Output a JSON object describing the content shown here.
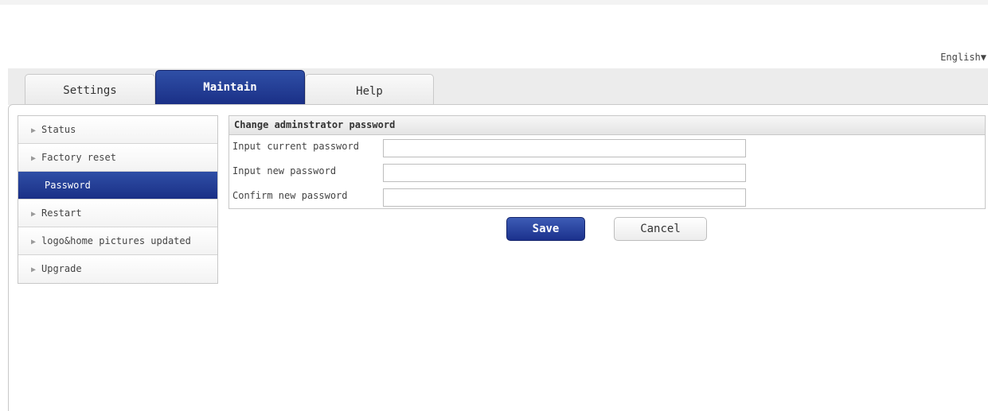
{
  "header": {
    "language": "English▼"
  },
  "tabs": [
    {
      "label": "Settings"
    },
    {
      "label": "Maintain"
    },
    {
      "label": "Help"
    }
  ],
  "sidebar": {
    "items": [
      {
        "label": "Status",
        "active": false
      },
      {
        "label": "Factory reset",
        "active": false
      },
      {
        "label": "Password",
        "active": true
      },
      {
        "label": "Restart",
        "active": false
      },
      {
        "label": "logo&home pictures updated",
        "active": false
      },
      {
        "label": "Upgrade",
        "active": false
      }
    ],
    "arrow": "▶"
  },
  "panel": {
    "title": "Change adminstrator password",
    "fields": [
      {
        "label": "Input current password",
        "value": ""
      },
      {
        "label": "Input new password",
        "value": ""
      },
      {
        "label": "Confirm new password",
        "value": ""
      }
    ]
  },
  "buttons": {
    "save": "Save",
    "cancel": "Cancel"
  },
  "colors": {
    "accent": "#1f3a93",
    "tab_inactive": "#f2f2f2",
    "border": "#c8c8c8"
  }
}
